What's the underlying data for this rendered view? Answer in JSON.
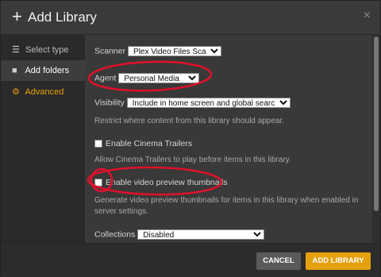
{
  "dialog": {
    "title": "Add Library",
    "plus_icon": "+",
    "close_icon": "×"
  },
  "sidebar": {
    "items": [
      {
        "label": "Select type",
        "icon": "list-icon"
      },
      {
        "label": "Add folders",
        "icon": "folder-icon"
      },
      {
        "label": "Advanced",
        "icon": "gear-icon"
      }
    ]
  },
  "form": {
    "scanner_label": "Scanner",
    "scanner_value": "Plex Video Files Scanner",
    "agent_label": "Agent",
    "agent_value": "Personal Media",
    "visibility_label": "Visibility",
    "visibility_value": "Include in home screen and global search",
    "visibility_help": "Restrict where content from this library should appear.",
    "cinema_trailers_label": "Enable Cinema Trailers",
    "cinema_trailers_help": "Allow Cinema Trailers to play before items in this library.",
    "video_preview_label": "Enable video preview thumbnails",
    "video_preview_help_1": "Generate video preview thumbnails for items in this library when enabled in",
    "video_preview_help_2": "server settings.",
    "collections_label": "Collections",
    "collections_value": "Disabled"
  },
  "footer": {
    "cancel_label": "CANCEL",
    "add_label": "ADD LIBRARY"
  },
  "colors": {
    "accent": "#e5a00d",
    "annotation": "#e0102a"
  }
}
